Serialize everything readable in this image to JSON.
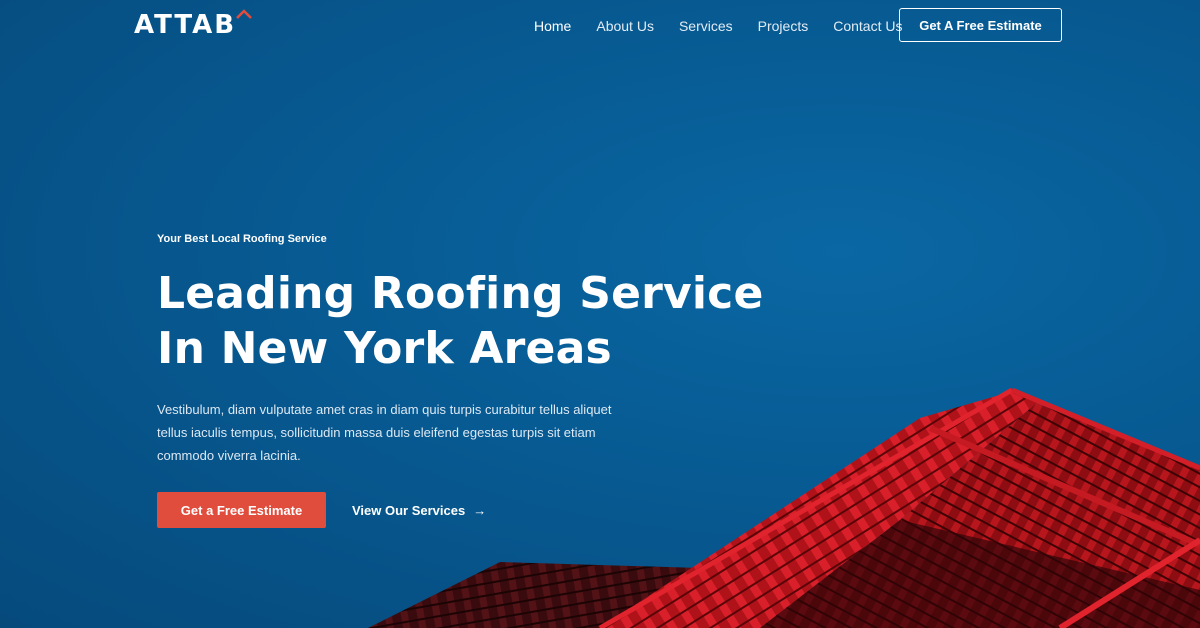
{
  "brand": {
    "name": "ATTAB",
    "accent_color": "#e14d3d"
  },
  "nav": {
    "items": [
      {
        "label": "Home",
        "active": true
      },
      {
        "label": "About Us",
        "active": false
      },
      {
        "label": "Services",
        "active": false
      },
      {
        "label": "Projects",
        "active": false
      },
      {
        "label": "Contact Us",
        "active": false
      }
    ],
    "cta_label": "Get A Free Estimate"
  },
  "hero": {
    "eyebrow": "Your Best Local Roofing Service",
    "headline_line1": "Leading Roofing Service",
    "headline_line2": "In New York Areas",
    "description": "Vestibulum, diam vulputate amet cras in diam quis turpis curabitur tellus aliquet tellus iaculis tempus, sollicitudin massa duis eleifend egestas turpis sit etiam commodo viverra lacinia.",
    "primary_button": "Get a Free Estimate",
    "secondary_link": "View Our Services",
    "secondary_icon": "arrow-right-icon",
    "arrow_glyph": "→",
    "background_color": "#075a92",
    "roof_color": "#c4161c"
  }
}
